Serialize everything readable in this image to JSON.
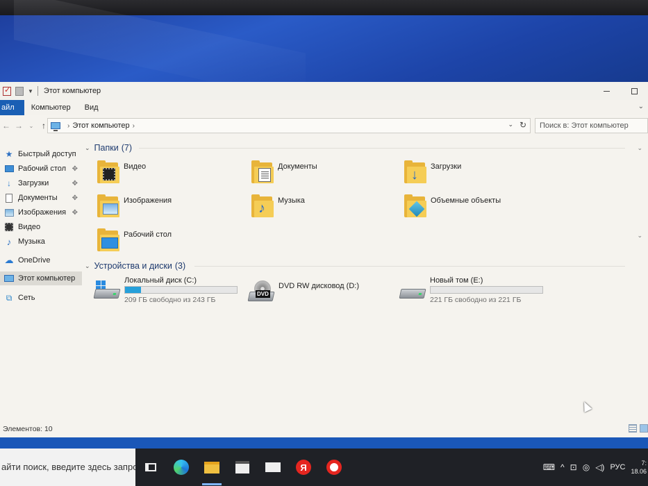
{
  "window": {
    "title": "Этот компьютер"
  },
  "ribbon": {
    "tabs": [
      "айл",
      "Компьютер",
      "Вид"
    ]
  },
  "address": {
    "path": "Этот компьютер",
    "search_placeholder": "Поиск в: Этот компьютер"
  },
  "sidebar": {
    "items": [
      {
        "label": "Быстрый доступ",
        "icon": "star-icon"
      },
      {
        "label": "Рабочий стол",
        "icon": "desktop-icon",
        "pinned": true
      },
      {
        "label": "Загрузки",
        "icon": "download-icon",
        "pinned": true
      },
      {
        "label": "Документы",
        "icon": "documents-icon",
        "pinned": true
      },
      {
        "label": "Изображения",
        "icon": "pictures-icon",
        "pinned": true
      },
      {
        "label": "Видео",
        "icon": "video-icon"
      },
      {
        "label": "Музыка",
        "icon": "music-icon"
      },
      {
        "label": "OneDrive",
        "icon": "cloud-icon"
      },
      {
        "label": "Этот компьютер",
        "icon": "computer-icon",
        "selected": true
      },
      {
        "label": "Сеть",
        "icon": "network-icon"
      }
    ]
  },
  "folders_group": {
    "title": "Папки",
    "count": "(7)",
    "items": [
      {
        "label": "Видео",
        "icon": "video-folder-icon"
      },
      {
        "label": "Документы",
        "icon": "documents-folder-icon"
      },
      {
        "label": "Загрузки",
        "icon": "downloads-folder-icon"
      },
      {
        "label": "Изображения",
        "icon": "pictures-folder-icon"
      },
      {
        "label": "Музыка",
        "icon": "music-folder-icon"
      },
      {
        "label": "Объемные объекты",
        "icon": "3d-objects-folder-icon"
      },
      {
        "label": "Рабочий стол",
        "icon": "desktop-folder-icon"
      }
    ]
  },
  "drives_group": {
    "title": "Устройства и диски",
    "count": "(3)",
    "items": [
      {
        "label": "Локальный диск (C:)",
        "free_text": "209 ГБ свободно из 243 ГБ",
        "used_fraction": 0.14,
        "icon": "windows-drive-icon"
      },
      {
        "label": "DVD RW дисковод (D:)",
        "icon": "dvd-drive-icon",
        "badge": "DVD"
      },
      {
        "label": "Новый том (E:)",
        "free_text": "221 ГБ свободно из 221 ГБ",
        "used_fraction": 0.0,
        "icon": "hard-drive-icon"
      }
    ]
  },
  "status": {
    "items_text": "Элементов: 10"
  },
  "taskbar": {
    "search_text": "айти поиск, введите здесь запрос",
    "apps": [
      "task-view-icon",
      "edge-icon",
      "file-explorer-icon",
      "store-icon",
      "mail-icon",
      "yandex-icon",
      "yandex-browser-icon"
    ],
    "lang": "РУС",
    "time": "7:",
    "date": "18.06"
  }
}
